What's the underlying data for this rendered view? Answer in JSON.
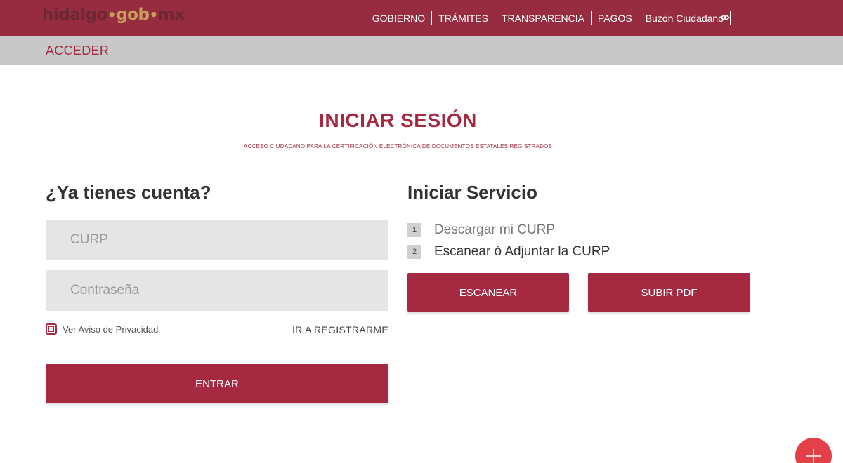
{
  "logo": {
    "part1": "hidalgo",
    "part2": "gob",
    "part3": "mx"
  },
  "nav": {
    "items": [
      "GOBIERNO",
      "TRÁMITES",
      "TRANSPARENCIA",
      "PAGOS",
      "Buzón Ciudadano"
    ],
    "accessibility_icon": "eye-icon"
  },
  "subbar": {
    "title": "ACCEDER"
  },
  "header": {
    "title": "INICIAR SESIÓN",
    "subtitle": "ACCESO CIUDADANO PARA LA CERTIFICACIÓN ELECTRÓNICA DE DOCUMENTOS ESTATALES REGISTRADOS"
  },
  "login": {
    "heading": "¿Ya tienes cuenta?",
    "curp_placeholder": "CURP",
    "password_placeholder": "Contraseña",
    "privacy_label": "Ver Aviso de Privacidad",
    "register_link": "IR A REGISTRARME",
    "submit_label": "ENTRAR"
  },
  "service": {
    "heading": "Iniciar Servicio",
    "steps": [
      {
        "number": "1",
        "label": "Descargar mi CURP"
      },
      {
        "number": "2",
        "label": "Escanear ó Adjuntar la CURP"
      }
    ],
    "scan_label": "ESCANEAR",
    "upload_label": "SUBIR PDF"
  },
  "fab": {
    "icon": "plus-icon"
  },
  "colors": {
    "brand": "#972b40",
    "accent": "#a52a41",
    "gold": "#c6a05a",
    "fab": "#e3404a"
  }
}
